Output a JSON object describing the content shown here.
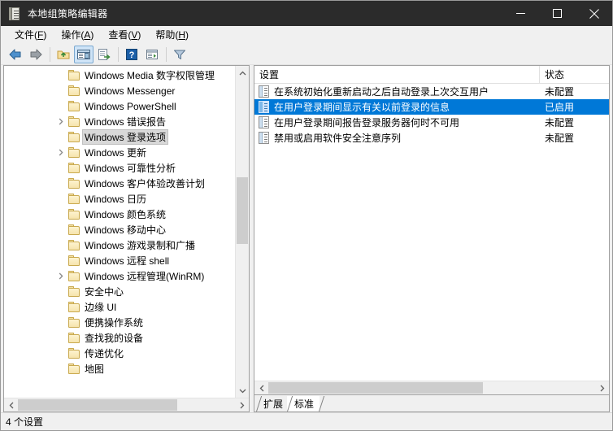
{
  "window": {
    "title": "本地组策略编辑器",
    "icon": "gpedit-book-icon",
    "controls": {
      "minimize": "minimize-icon",
      "maximize": "maximize-icon",
      "close": "close-icon"
    }
  },
  "menubar": {
    "items": [
      {
        "label": "文件(F)",
        "text": "文件(",
        "accel": "F",
        "tail": ")"
      },
      {
        "label": "操作(A)",
        "text": "操作(",
        "accel": "A",
        "tail": ")"
      },
      {
        "label": "查看(V)",
        "text": "查看(",
        "accel": "V",
        "tail": ")"
      },
      {
        "label": "帮助(H)",
        "text": "帮助(",
        "accel": "H",
        "tail": ")"
      }
    ]
  },
  "toolbar": {
    "buttons": [
      {
        "name": "back-icon",
        "pressed": false
      },
      {
        "name": "forward-icon",
        "pressed": false
      },
      {
        "name": "up-folder-icon",
        "pressed": false
      },
      {
        "name": "show-hide-tree-icon",
        "pressed": true
      },
      {
        "name": "export-list-icon",
        "pressed": false
      },
      {
        "name": "help-icon",
        "pressed": false
      },
      {
        "name": "properties-icon",
        "pressed": false
      },
      {
        "name": "filter-icon",
        "pressed": false
      }
    ]
  },
  "tree": {
    "selected_index": 4,
    "nodes": [
      {
        "label": "Windows Media 数字权限管理",
        "expandable": false,
        "selected": false
      },
      {
        "label": "Windows Messenger",
        "expandable": false,
        "selected": false
      },
      {
        "label": "Windows PowerShell",
        "expandable": false,
        "selected": false
      },
      {
        "label": "Windows 错误报告",
        "expandable": true,
        "selected": false
      },
      {
        "label": "Windows 登录选项",
        "expandable": false,
        "selected": true
      },
      {
        "label": "Windows 更新",
        "expandable": true,
        "selected": false
      },
      {
        "label": "Windows 可靠性分析",
        "expandable": false,
        "selected": false
      },
      {
        "label": "Windows 客户体验改善计划",
        "expandable": false,
        "selected": false
      },
      {
        "label": "Windows 日历",
        "expandable": false,
        "selected": false
      },
      {
        "label": "Windows 颜色系统",
        "expandable": false,
        "selected": false
      },
      {
        "label": "Windows 移动中心",
        "expandable": false,
        "selected": false
      },
      {
        "label": "Windows 游戏录制和广播",
        "expandable": false,
        "selected": false
      },
      {
        "label": "Windows 远程 shell",
        "expandable": false,
        "selected": false
      },
      {
        "label": "Windows 远程管理(WinRM)",
        "expandable": true,
        "selected": false
      },
      {
        "label": "安全中心",
        "expandable": false,
        "selected": false
      },
      {
        "label": "边缘 UI",
        "expandable": false,
        "selected": false
      },
      {
        "label": "便携操作系统",
        "expandable": false,
        "selected": false
      },
      {
        "label": "查找我的设备",
        "expandable": false,
        "selected": false
      },
      {
        "label": "传递优化",
        "expandable": false,
        "selected": false
      },
      {
        "label": "地图",
        "expandable": false,
        "selected": false
      }
    ]
  },
  "list": {
    "columns": {
      "setting": "设置",
      "state": "状态"
    },
    "rows": [
      {
        "name": "在系统初始化重新启动之后自动登录上次交互用户",
        "state": "未配置",
        "selected": false
      },
      {
        "name": "在用户登录期间显示有关以前登录的信息",
        "state": "已启用",
        "selected": true
      },
      {
        "name": "在用户登录期间报告登录服务器何时不可用",
        "state": "未配置",
        "selected": false
      },
      {
        "name": "禁用或启用软件安全注意序列",
        "state": "未配置",
        "selected": false
      }
    ]
  },
  "tabs": {
    "items": [
      {
        "label": "扩展",
        "active": false
      },
      {
        "label": "标准",
        "active": true
      }
    ]
  },
  "statusbar": {
    "text": "4 个设置"
  },
  "colors": {
    "titlebar_bg": "#2b2b2b",
    "selection_blue": "#0078d7",
    "tree_selection_gray": "#d8d8d8",
    "chrome_bg": "#f0f0f0",
    "pane_bg": "#ffffff"
  }
}
